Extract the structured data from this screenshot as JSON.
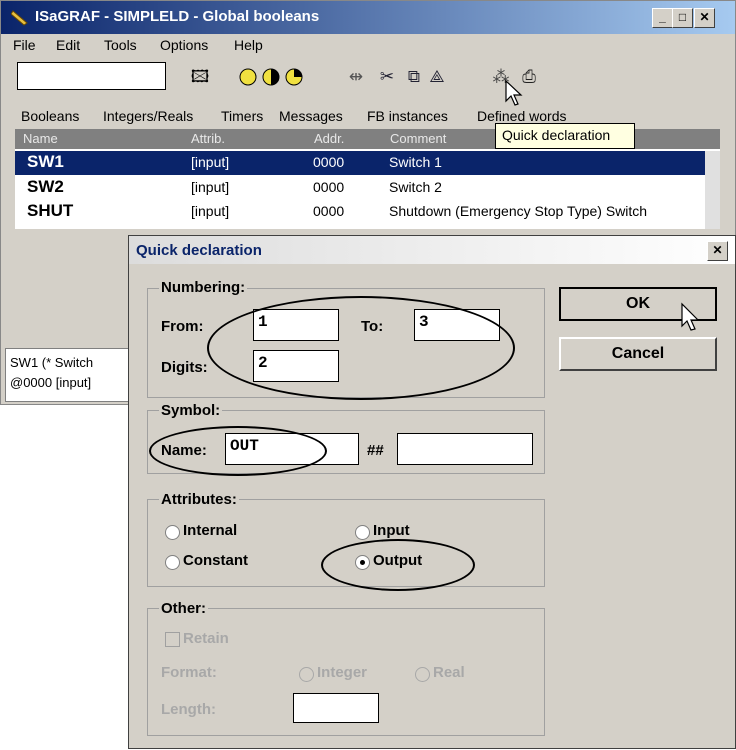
{
  "window": {
    "title": "ISaGRAF - SIMPLELD - Global booleans",
    "minimize": "_",
    "maximize": "□",
    "close": "✕"
  },
  "menu": [
    "File",
    "Edit",
    "Tools",
    "Options",
    "Help"
  ],
  "toolbar": {
    "search_value": "",
    "icons": [
      "open-folder-icon",
      "yellow-circle-icon",
      "half-circle-icon",
      "quarter-circle-icon",
      "indent-icon",
      "cut-icon",
      "copy-icon",
      "paint-icon",
      "quick-declaration-icon",
      "print-icon"
    ]
  },
  "tabs": [
    "Booleans",
    "Integers/Reals",
    "Timers",
    "Messages",
    "FB instances",
    "Defined words"
  ],
  "grid": {
    "columns": [
      "Name",
      "Attrib.",
      "Addr.",
      "Comment"
    ],
    "rows": [
      {
        "name": "SW1",
        "attrib": "[input]",
        "addr": "0000",
        "comment": "Switch 1"
      },
      {
        "name": "SW2",
        "attrib": "[input]",
        "addr": "0000",
        "comment": "Switch 2"
      },
      {
        "name": "SHUT",
        "attrib": "[input]",
        "addr": "0000",
        "comment": "Shutdown (Emergency Stop Type) Switch"
      }
    ]
  },
  "tooltip": "Quick declaration",
  "status": {
    "line1": "SW1   (* Switch",
    "line2": "@0000  [input]"
  },
  "dialog": {
    "title": "Quick declaration",
    "close": "✕",
    "numbering": {
      "label": "Numbering:",
      "from_label": "From:",
      "from_value": "1",
      "to_label": "To:",
      "to_value": "3",
      "digits_label": "Digits:",
      "digits_value": "2"
    },
    "symbol": {
      "label": "Symbol:",
      "name_label": "Name:",
      "name_value": "OUT",
      "hash_label": "##",
      "suffix_value": ""
    },
    "attributes": {
      "label": "Attributes:",
      "internal": "Internal",
      "input": "Input",
      "constant": "Constant",
      "output": "Output",
      "selected": "Output"
    },
    "other": {
      "label": "Other:",
      "retain": "Retain",
      "format_label": "Format:",
      "integer": "Integer",
      "real": "Real",
      "length_label": "Length:",
      "length_value": ""
    },
    "ok": "OK",
    "cancel": "Cancel"
  },
  "colors": {
    "title_bar": "#0a246a",
    "selection": "#0a246a",
    "face": "#d4d0c8",
    "tooltip": "#ffffe1"
  }
}
